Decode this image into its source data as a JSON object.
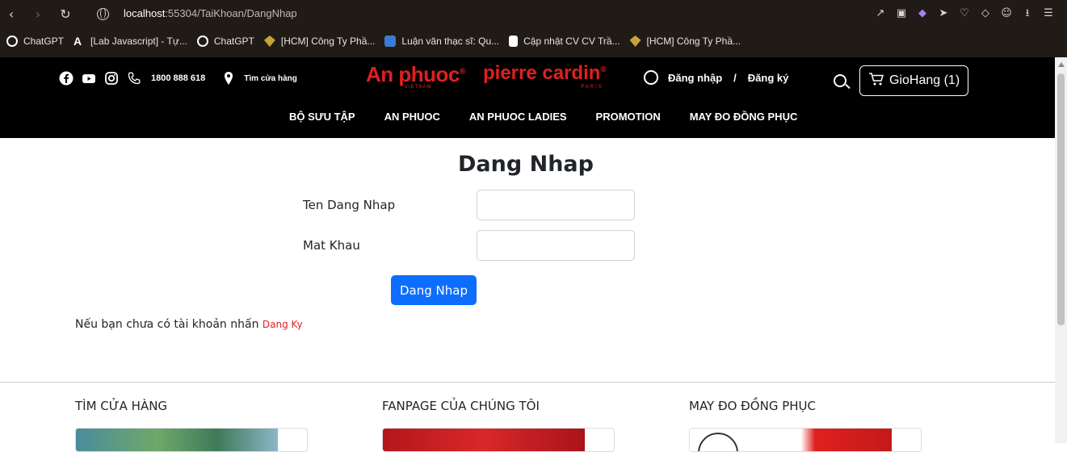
{
  "browser": {
    "url_host": "localhost",
    "url_path": ":55304/TaiKhoan/DangNhap",
    "bookmarks": [
      {
        "label": "ChatGPT",
        "color": "#ffffff"
      },
      {
        "label": "[Lab Javascript] - Tự...",
        "color": "#ffffff"
      },
      {
        "label": "ChatGPT",
        "color": "#ffffff"
      },
      {
        "label": "[HCM] Công Ty Phầ...",
        "color": "#c9a23a"
      },
      {
        "label": "Luận văn thạc sĩ: Qu...",
        "color": "#3a7bd5"
      },
      {
        "label": "Cập nhật CV CV Trầ...",
        "color": "#ffffff"
      },
      {
        "label": "[HCM] Công Ty Phầ...",
        "color": "#c9a23a"
      }
    ]
  },
  "header": {
    "phone": "1800 888 618",
    "store_finder": "Tìm cửa hàng",
    "logo_anphuoc": "An phuoc",
    "logo_anphuoc_sub": "VIETNAM",
    "logo_pierre": "pierre cardin",
    "logo_pierre_sub": "PARIS",
    "login_link": "Đăng nhập",
    "separator": "/",
    "register_link": "Đăng ký",
    "cart_label": "GioHang (1)",
    "nav": [
      "BỘ SƯU TẬP",
      "AN PHUOC",
      "AN PHUOC LADIES",
      "PROMOTION",
      "MAY ĐO ĐỒNG PHỤC"
    ]
  },
  "login": {
    "title": "Dang Nhap",
    "username_label": "Ten Dang Nhap",
    "username_value": "",
    "password_label": "Mat Khau",
    "password_value": "",
    "submit_label": "Dang Nhap",
    "register_prompt": "Nếu bạn chưa có tài khoản nhấn",
    "register_link": "Dang Ky"
  },
  "footer": {
    "col1_title": "TÌM CỬA HÀNG",
    "col2_title": "FANPAGE CỦA CHÚNG TÔI",
    "col3_title": "MAY ĐO ĐỒNG PHỤC"
  },
  "colors": {
    "brand_red": "#e0201f",
    "primary_blue": "#0d6efd"
  }
}
